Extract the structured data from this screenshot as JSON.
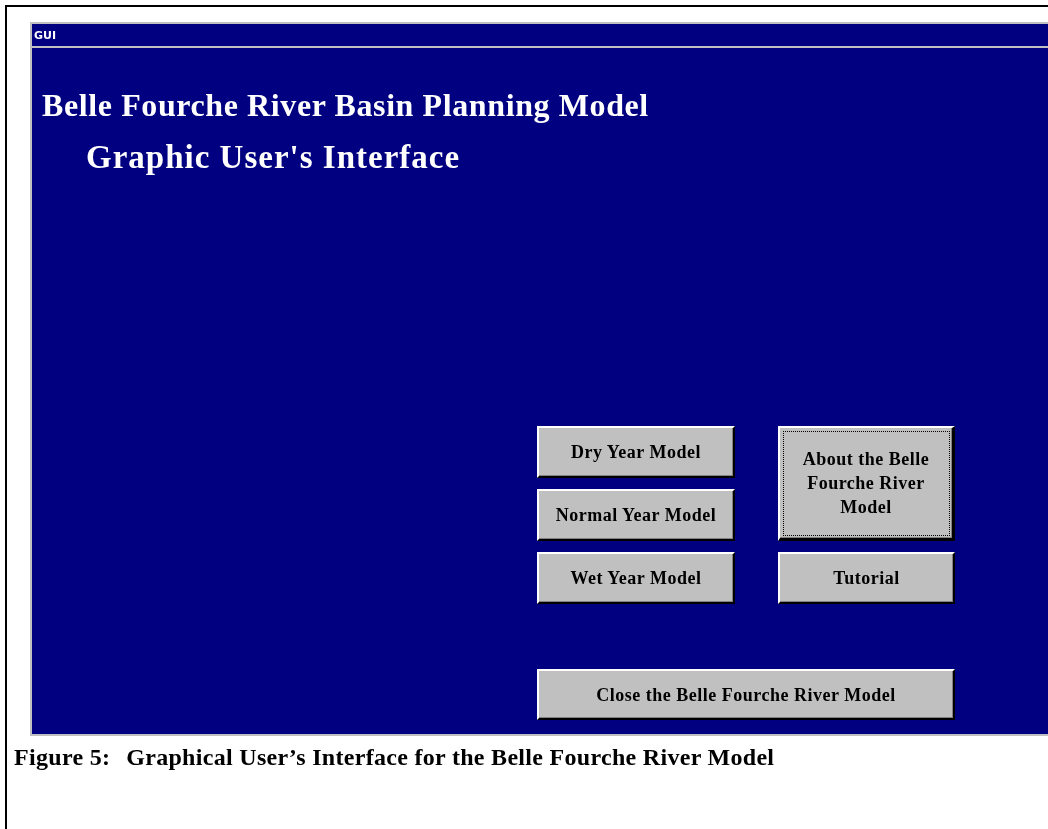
{
  "window": {
    "title": "GUI"
  },
  "headings": [
    "Belle Fourche River Basin Planning Model",
    "Graphic User's Interface"
  ],
  "buttons": [
    {
      "label": "Dry Year Model",
      "focused": false
    },
    {
      "label": "About the Belle Fourche River Model",
      "focused": true
    },
    {
      "label": "Normal Year Model",
      "focused": false
    },
    {
      "label": "Wet Year Model",
      "focused": false
    },
    {
      "label": "Tutorial",
      "focused": false
    },
    {
      "label": "Close the Belle Fourche River Model",
      "focused": false
    }
  ],
  "caption": {
    "number": "Figure 5:",
    "text": "Graphical User’s Interface for the Belle Fourche River Model"
  }
}
